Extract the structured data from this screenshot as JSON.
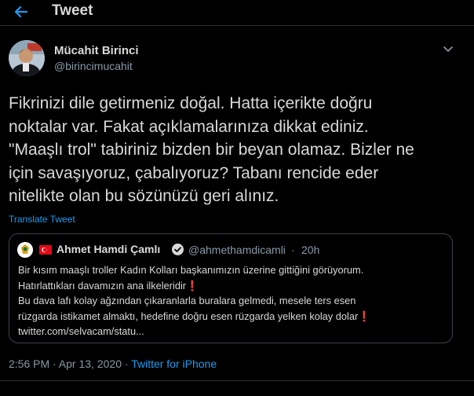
{
  "header": {
    "title": "Tweet",
    "back_icon": "arrow-left-icon",
    "accent": "#1d9bf0"
  },
  "tweet": {
    "author_name": "Mücahit Birinci",
    "author_handle": "@birincimucahit",
    "text_lines": [
      "Fikrinizi dile getirmeniz doğal. Hatta içerikte doğru",
      "noktalar var. Fakat açıklamalarınıza dikkat ediniz.",
      "\"Maaşlı trol\" tabiriniz bizden bir beyan olamaz. Bizler ne",
      "için savaşıyoruz, çabalıyoruz? Tabanı rencide eder",
      "nitelikte olan bu sözünüzü geri alınız."
    ],
    "translate_label": "Translate Tweet",
    "timestamp": "2:56 PM · Apr 13, 2020",
    "separator": "·",
    "source": "Twitter for iPhone"
  },
  "quote": {
    "name": "Ahmet Hamdi Çamlı",
    "handle": "@ahmethamdicamli",
    "dot": "·",
    "time": "20h",
    "lines": [
      "Bir kısım maaşlı troller Kadın Kolları başkanımızın üzerine gittiğini görüyorum.",
      "Hatırlattıkları davamızın ana ilkeleridir",
      "Bu dava lafı kolay ağzından çıkaranlarla buralara gelmedi, mesele ters esen",
      "rüzgarda istikamet almaktı, hedefine doğru esen rüzgarda yelken kolay dolar",
      "twitter.com/selvacam/statu..."
    ],
    "exclamation": "❗"
  },
  "colors": {
    "background": "#000000",
    "text": "#d9d9d9",
    "secondary": "#8899a6",
    "link": "#1d9bf0",
    "border": "#38444d",
    "exclamation": "#e0245e"
  }
}
